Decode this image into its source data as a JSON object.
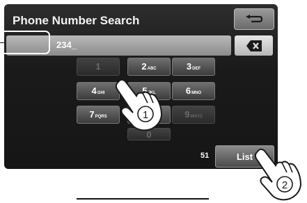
{
  "header": {
    "title": "Phone Number Search",
    "back_icon": "return-arrow-icon",
    "delete_icon": "backspace-icon"
  },
  "number_field": {
    "value": "234_"
  },
  "keypad": {
    "keys": [
      {
        "digit": "1",
        "sub": "",
        "enabled": false
      },
      {
        "digit": "2",
        "sub": "ABC",
        "enabled": true
      },
      {
        "digit": "3",
        "sub": "DEF",
        "enabled": true
      },
      {
        "digit": "4",
        "sub": "GHI",
        "enabled": true
      },
      {
        "digit": "5",
        "sub": "JKL",
        "enabled": true
      },
      {
        "digit": "6",
        "sub": "MNO",
        "enabled": true
      },
      {
        "digit": "7",
        "sub": "PQRS",
        "enabled": true
      },
      {
        "digit": "",
        "sub": "",
        "enabled": true
      },
      {
        "digit": "9",
        "sub": "WXYZ",
        "enabled": false
      },
      {
        "digit": "0",
        "sub": "",
        "enabled": false
      }
    ]
  },
  "result": {
    "count": "51",
    "list_label": "List"
  },
  "callouts": {
    "step1": "1",
    "step2": "2"
  },
  "colors": {
    "screen_bg": "#1a1a1a",
    "key_bg": "#555555",
    "field_bg": "#a0a0a0"
  }
}
